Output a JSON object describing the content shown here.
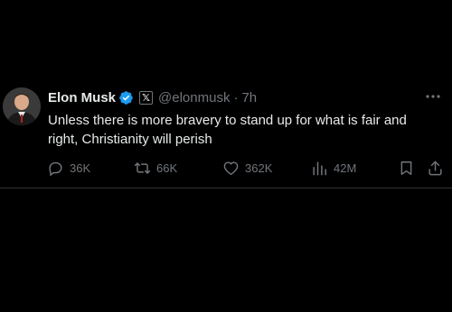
{
  "tweet": {
    "author_name": "Elon Musk",
    "handle": "@elonmusk",
    "separator": "·",
    "time": "7h",
    "affiliation_badge": "𝕏",
    "text": "Unless there is more bravery to stand up for what is fair and right, Christianity will perish",
    "stats": {
      "replies": "36K",
      "retweets": "66K",
      "likes": "362K",
      "views": "42M"
    }
  },
  "colors": {
    "background": "#000000",
    "primary_text": "#e7e9ea",
    "secondary_text": "#71767b",
    "verified_blue": "#1d9bf0",
    "divider": "#2f3336"
  },
  "icons": [
    "verified-badge-icon",
    "x-logo-icon",
    "more-icon",
    "reply-icon",
    "retweet-icon",
    "like-icon",
    "views-icon",
    "bookmark-icon",
    "share-icon"
  ]
}
